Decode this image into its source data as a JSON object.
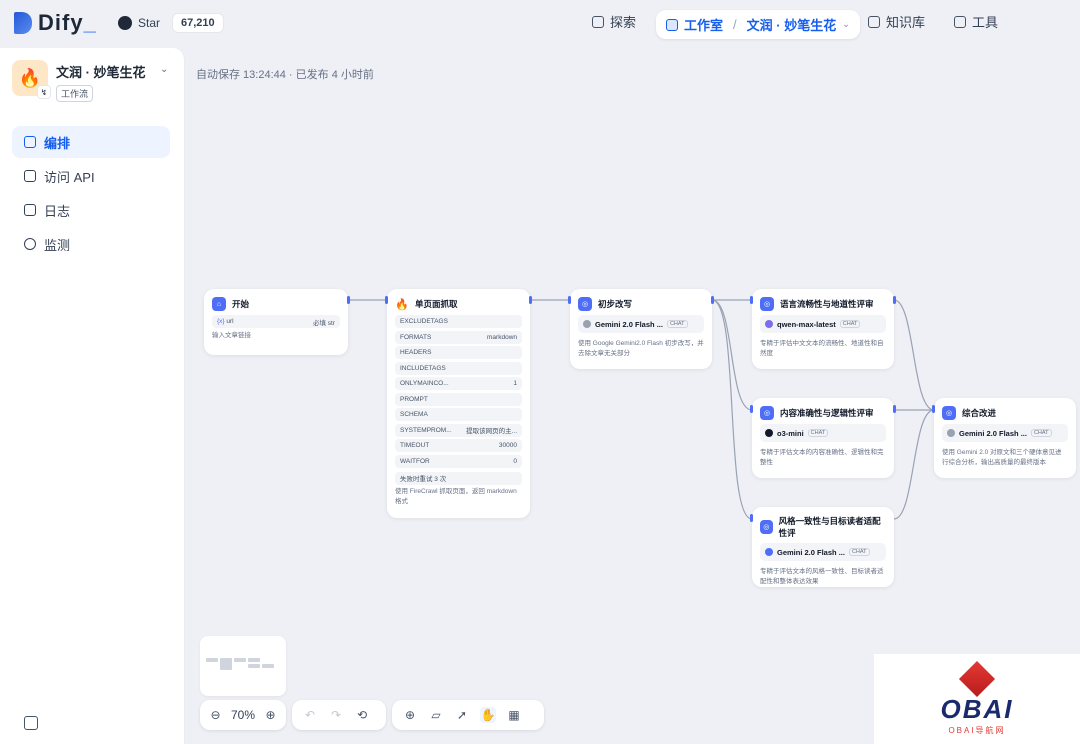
{
  "brand": {
    "name": "Dify",
    "underscore": "_"
  },
  "github": {
    "label": "Star",
    "count": "67,210"
  },
  "nav": {
    "explore": "探索",
    "workspace": "工作室",
    "app_crumb": "文润 · 妙笔生花",
    "knowledge": "知识库",
    "tools": "工具"
  },
  "app": {
    "name": "文润 · 妙笔生花",
    "type": "工作流"
  },
  "menu": [
    "编排",
    "访问 API",
    "日志",
    "监测"
  ],
  "save_status": "自动保存 13:24:44 · 已发布 4 小时前",
  "nodes": {
    "start": {
      "title": "开始",
      "var_name": "url",
      "var_req": "必填",
      "var_type": "str",
      "desc": "输入文章链接"
    },
    "scrape": {
      "title": "单页面抓取",
      "fields": [
        {
          "k": "EXCLUDETAGS",
          "v": ""
        },
        {
          "k": "FORMATS",
          "v": "markdown"
        },
        {
          "k": "HEADERS",
          "v": ""
        },
        {
          "k": "INCLUDETAGS",
          "v": ""
        },
        {
          "k": "ONLYMAINCO...",
          "v": "1"
        },
        {
          "k": "PROMPT",
          "v": ""
        },
        {
          "k": "SCHEMA",
          "v": ""
        },
        {
          "k": "SYSTEMPROM...",
          "v": "提取该网页的主..."
        },
        {
          "k": "TIMEOUT",
          "v": "30000"
        },
        {
          "k": "WAITFOR",
          "v": "0"
        }
      ],
      "retry": "失败时重试 3 次",
      "desc": "使用 FireCrawl 抓取页面，返回 markdown 格式"
    },
    "draft": {
      "title": "初步改写",
      "model": "Gemini 2.0 Flash ...",
      "chat": "CHAT",
      "desc": "使用 Google Gemini2.0 Flash 初步改写，并去除文章无关部分"
    },
    "fluency": {
      "title": "语言流畅性与地道性评审",
      "model": "qwen-max-latest",
      "chat": "CHAT",
      "desc": "专精于评估中文文本的流畅性、地道性和自然度"
    },
    "accuracy": {
      "title": "内容准确性与逻辑性评审",
      "model": "o3-mini",
      "chat": "CHAT",
      "desc": "专精于评估文本的内容准确性、逻辑性和完整性"
    },
    "style": {
      "title": "风格一致性与目标读者适配性评",
      "model": "Gemini 2.0 Flash ...",
      "chat": "CHAT",
      "desc": "专精于评估文本的风格一致性、目标读者适配性和整体表达效果"
    },
    "final": {
      "title": "综合改进",
      "model": "Gemini 2.0 Flash ...",
      "chat": "CHAT",
      "desc": "使用 Gemini 2.0 对原文和三个硬体意见进行综合分析，输出高质量的最终版本"
    }
  },
  "toolbar": {
    "zoom": "70%"
  },
  "watermark": {
    "logo": "OBAI",
    "sub": "OBAI导航网"
  },
  "colors": {
    "accent": "#155eef",
    "node_icon": "#4f6ef7",
    "edge": "#98a2b3"
  }
}
